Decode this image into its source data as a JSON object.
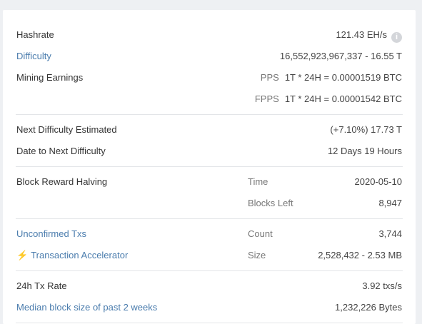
{
  "hashrate": {
    "label": "Hashrate",
    "value": "121.43 EH/s"
  },
  "difficulty": {
    "label": "Difficulty",
    "value": "16,552,923,967,337 - 16.55 T"
  },
  "mining_earnings": {
    "label": "Mining Earnings",
    "pps_tag": "PPS",
    "pps_value": "1T * 24H = 0.00001519 BTC",
    "fpps_tag": "FPPS",
    "fpps_value": "1T * 24H = 0.00001542 BTC"
  },
  "next_difficulty": {
    "label": "Next Difficulty Estimated",
    "value": "(+7.10%) 17.73 T"
  },
  "date_next": {
    "label": "Date to Next Difficulty",
    "value": "12 Days 19 Hours"
  },
  "halving": {
    "label": "Block Reward Halving",
    "time_label": "Time",
    "time_value": "2020-05-10",
    "blocks_label": "Blocks Left",
    "blocks_value": "8,947"
  },
  "unconfirmed": {
    "label": "Unconfirmed Txs",
    "count_label": "Count",
    "count_value": "3,744",
    "accelerator_label": "Transaction Accelerator",
    "size_label": "Size",
    "size_value": "2,528,432 - 2.53 MB"
  },
  "tx_rate": {
    "label": "24h Tx Rate",
    "value": "3.92 txs/s"
  },
  "median_block": {
    "label": "Median block size of past 2 weeks",
    "value": "1,232,226 Bytes"
  }
}
